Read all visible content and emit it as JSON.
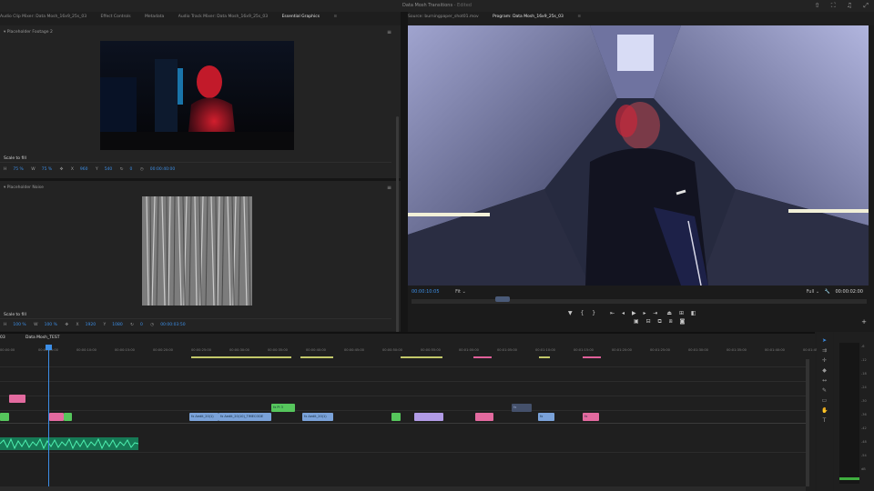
{
  "window": {
    "title": "Data Mosh Transitions",
    "status": " - Edited",
    "icons": [
      "share-icon",
      "fullscreen-icon",
      "notification-icon",
      "expand-icon"
    ]
  },
  "left_tabs": [
    {
      "label": "Audio Clip Mixer: Data Mosh_16x9_25s_03",
      "active": false
    },
    {
      "label": "Effect Controls",
      "active": false
    },
    {
      "label": "Metadata",
      "active": false
    },
    {
      "label": "Audio Track Mixer: Data Mosh_16x9_25s_03",
      "active": false
    },
    {
      "label": "Essential Graphics",
      "active": true
    }
  ],
  "right_tabs": [
    {
      "label": "Source: burningpaper_shot01.mov",
      "active": false
    },
    {
      "label": "Program: Data Mosh_16x9_25s_03",
      "active": true
    }
  ],
  "tab_menu_glyph": "≡",
  "eg_panel": {
    "placeholder1": {
      "title": "Placeholder Footage 2",
      "scale_label": "Scale to fill",
      "controls": {
        "h": "H",
        "h_val": "75 %",
        "w": "W",
        "w_val": "75 %",
        "x": "X",
        "x_val": "960",
        "y": "Y",
        "y_val": "540",
        "rot_val": "0",
        "time": "00:00:40:00"
      }
    },
    "placeholder2": {
      "title": "Placeholder Noise",
      "scale_label": "Scale to fill",
      "controls": {
        "h": "H",
        "h_val": "100 %",
        "w": "W",
        "w_val": "100 %",
        "x": "X",
        "x_val": "1920",
        "y": "Y",
        "y_val": "1080",
        "rot_val": "0",
        "time": "00:00:03:50"
      }
    }
  },
  "program_monitor": {
    "timecode": "00:00:10:05",
    "fit": "Fit",
    "quality": "Full",
    "duration": "00:00:02:00",
    "zoom_glyph": "⌄"
  },
  "transport": {
    "row1": [
      "marker-icon",
      "in-point-icon",
      "out-point-icon",
      "go-to-in-icon",
      "step-back-icon",
      "play-icon",
      "step-forward-icon",
      "go-to-out-icon",
      "lift-icon",
      "extract-icon",
      "export-frame-icon"
    ],
    "row2": [
      "lock-icon",
      "extract-icon-2",
      "button-editor-icon",
      "compare-icon",
      "camera-icon"
    ]
  },
  "timeline": {
    "sequence_tab": "Data Mosh_TEST",
    "seq_left": "03",
    "timecodes": [
      "00:00:00",
      "00:00:05:00",
      "00:00:10:00",
      "00:00:15:00",
      "00:00:20:00",
      "00:00:25:00",
      "00:00:30:00",
      "00:00:35:00",
      "00:00:40:00",
      "00:00:45:00",
      "00:00:50:00",
      "00:00:55:00",
      "00:01:00:00",
      "00:01:05:00",
      "00:01:10:00",
      "00:01:15:00",
      "00:01:20:00",
      "00:01:25:00",
      "00:01:30:00",
      "00:01:35:00",
      "00:01:40:00",
      "00:01:45:00"
    ],
    "clips_v": [
      {
        "label": "",
        "color": "pink"
      },
      {
        "label": "",
        "color": "green"
      },
      {
        "label": "",
        "color": "pink"
      },
      {
        "label": "",
        "color": "green"
      },
      {
        "label": "fx Pl 3",
        "color": "green"
      },
      {
        "label": "fx Aedit_20(1)",
        "color": "blue"
      },
      {
        "label": "fx Aedit_20(10)_TIMECODE",
        "color": "blue"
      },
      {
        "label": "fx Aedit_20(1)",
        "color": "blue"
      },
      {
        "label": "",
        "color": "green"
      },
      {
        "label": "",
        "color": "purple"
      },
      {
        "label": "",
        "color": "pink"
      },
      {
        "label": "fx",
        "color": "dark"
      },
      {
        "label": "fx",
        "color": "blue"
      },
      {
        "label": "fx",
        "color": "pink"
      }
    ]
  },
  "tools": [
    "selection-tool-icon",
    "track-select-icon",
    "ripple-edit-icon",
    "razor-icon",
    "slip-icon",
    "pen-icon",
    "rectangle-icon",
    "hand-icon",
    "type-icon"
  ],
  "audio_meter": {
    "scale": [
      "-6",
      "-12",
      "-18",
      "-24",
      "-30",
      "-36",
      "-42",
      "-48",
      "-54",
      "dB"
    ]
  },
  "colors": {
    "accent": "#3c8ee6",
    "playhead": "#3c8ee6",
    "clip_blue": "#7aa2d9",
    "clip_green": "#56c65c",
    "clip_pink": "#e36a9f",
    "clip_purple": "#b19be6",
    "audio_green": "#36c48a"
  }
}
